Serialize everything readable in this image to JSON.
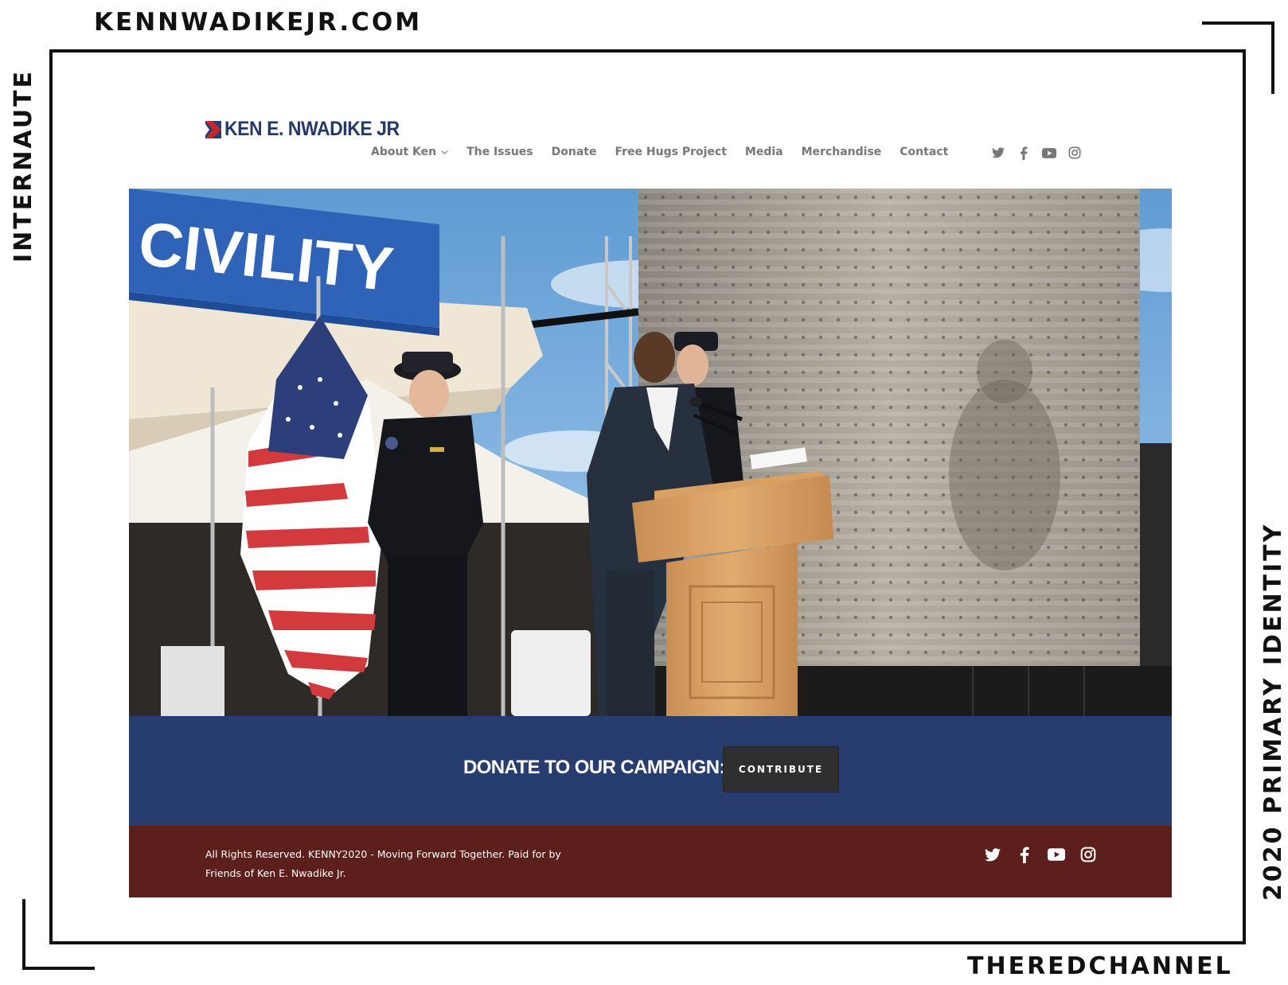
{
  "frame": {
    "site_url": "KENNWADIKEJR.COM",
    "left_label": "INTERNAUTE",
    "right_label": "2020 PRIMARY IDENTITY",
    "bottom_label": "THEREDCHANNEL"
  },
  "header": {
    "logo_text": "KEN E. NWADIKE JR",
    "nav": [
      {
        "label": "About Ken",
        "has_dropdown": true
      },
      {
        "label": "The Issues"
      },
      {
        "label": "Donate"
      },
      {
        "label": "Free Hugs Project"
      },
      {
        "label": "Media"
      },
      {
        "label": "Merchandise"
      },
      {
        "label": "Contact"
      }
    ],
    "social_icons": [
      "twitter-icon",
      "facebook-icon",
      "youtube-icon",
      "instagram-icon"
    ]
  },
  "hero": {
    "banner_text": "CIVILITY"
  },
  "donate": {
    "label": "DONATE TO OUR CAMPAIGN:",
    "button_label": "CONTRIBUTE"
  },
  "footer": {
    "text": "All Rights Reserved. KENNY2020 - Moving Forward Together. Paid for by Friends of Ken E. Nwadike Jr.",
    "social_icons": [
      "twitter-icon",
      "facebook-icon",
      "youtube-icon",
      "instagram-icon"
    ]
  },
  "colors": {
    "brand_navy": "#273c6f",
    "brand_red": "#c4262e",
    "footer_maroon": "#5c1f1b",
    "button_dark": "#2f2f31",
    "nav_gray": "#777777"
  }
}
